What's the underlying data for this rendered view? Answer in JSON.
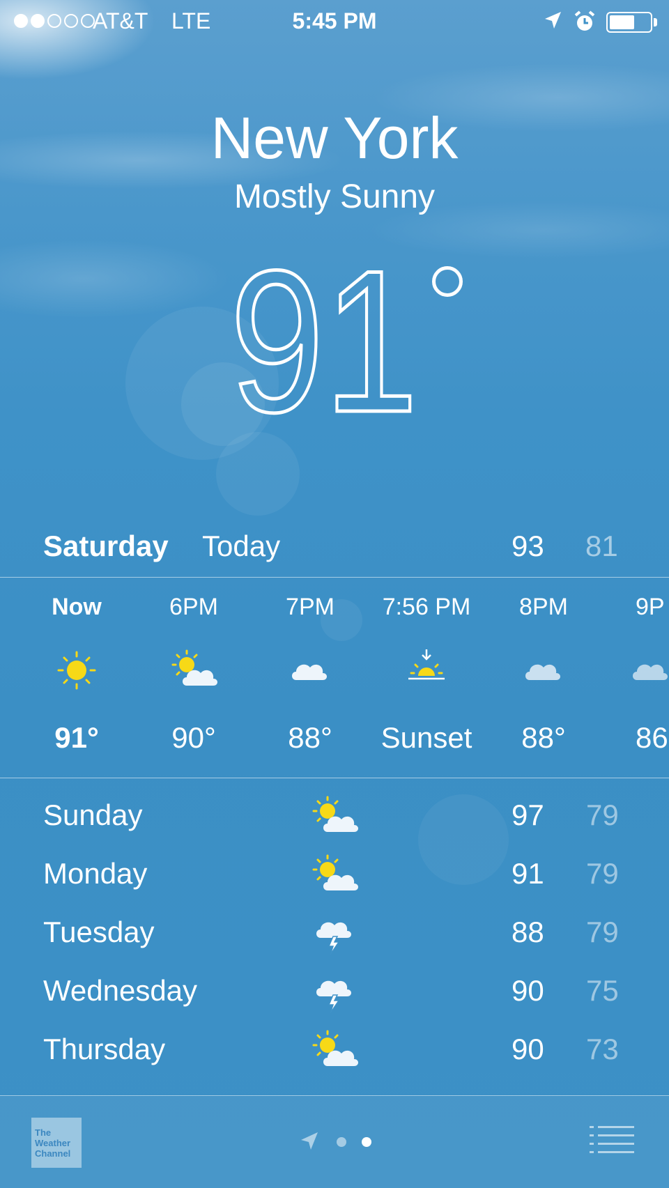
{
  "status_bar": {
    "carrier": "AT&T",
    "network": "LTE",
    "time": "5:45 PM",
    "signal_bars_filled": 2,
    "signal_bars_total": 5,
    "battery_level": 0.6,
    "icons": [
      "location-arrow-icon",
      "alarm-clock-icon",
      "battery-icon"
    ]
  },
  "location": {
    "city": "New York",
    "condition": "Mostly Sunny",
    "temperature": "91"
  },
  "today": {
    "day": "Saturday",
    "label": "Today",
    "high": "93",
    "low": "81"
  },
  "hourly": [
    {
      "time": "Now",
      "icon": "sun-icon",
      "temp": "91°"
    },
    {
      "time": "6PM",
      "icon": "partly-cloudy-icon",
      "temp": "90°"
    },
    {
      "time": "7PM",
      "icon": "cloud-icon",
      "temp": "88°"
    },
    {
      "time": "7:56 PM",
      "icon": "sunset-icon",
      "temp": "Sunset"
    },
    {
      "time": "8PM",
      "icon": "cloud-icon",
      "temp": "88°"
    },
    {
      "time": "9P",
      "icon": "cloud-icon",
      "temp": "86"
    }
  ],
  "daily": [
    {
      "day": "Sunday",
      "icon": "partly-cloudy-icon",
      "high": "97",
      "low": "79"
    },
    {
      "day": "Monday",
      "icon": "partly-cloudy-icon",
      "high": "91",
      "low": "79"
    },
    {
      "day": "Tuesday",
      "icon": "thunderstorm-icon",
      "high": "88",
      "low": "79"
    },
    {
      "day": "Wednesday",
      "icon": "thunderstorm-icon",
      "high": "90",
      "low": "75"
    },
    {
      "day": "Thursday",
      "icon": "partly-cloudy-icon",
      "high": "90",
      "low": "73"
    }
  ],
  "footer": {
    "logo_text": [
      "The",
      "Weather",
      "Channel"
    ],
    "page_indicator_active": 2,
    "icons": [
      "location-arrow-icon",
      "list-icon"
    ]
  },
  "colors": {
    "sky": "#3d91c6",
    "sun": "#f7d917",
    "text": "#ffffff"
  }
}
